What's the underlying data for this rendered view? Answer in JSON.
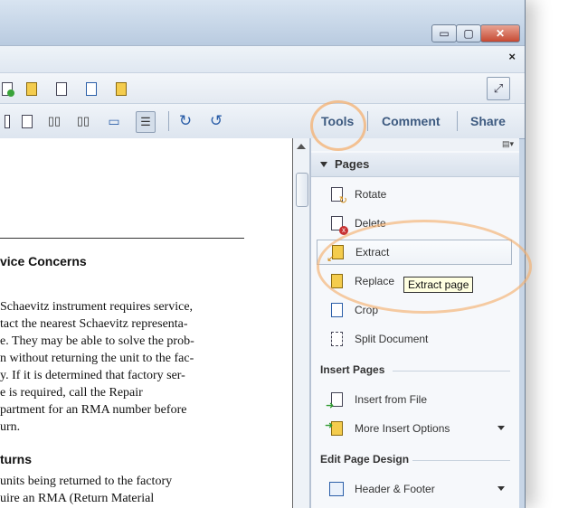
{
  "toolbar": {
    "tabs": {
      "tools": "Tools",
      "comment": "Comment",
      "share": "Share"
    },
    "menu_close": "×"
  },
  "window_controls": {
    "minimize": "▭",
    "maximize": "▢",
    "close": "✕"
  },
  "document": {
    "heading1": "vice Concerns",
    "para1": [
      "Schaevitz instrument requires service,",
      "tact the nearest Schaevitz representa-",
      "e. They may be able to solve the prob-",
      "n without returning the unit to the fac-",
      "y. If it is determined that factory ser-",
      "e is required, call the Repair",
      "partment for an RMA number before",
      "urn."
    ],
    "heading2": "turns",
    "para2": [
      "units being returned to the factory",
      "uire an RMA (Return Material"
    ]
  },
  "pane": {
    "options_icon": "▤▾",
    "section": "Pages",
    "pages_items": [
      {
        "label": "Rotate"
      },
      {
        "label": "Delete"
      },
      {
        "label": "Extract"
      },
      {
        "label": "Replace"
      },
      {
        "label": "Crop"
      },
      {
        "label": "Split Document"
      }
    ],
    "insert_title": "Insert Pages",
    "insert_items": [
      {
        "label": "Insert from File"
      },
      {
        "label": "More Insert Options"
      }
    ],
    "design_title": "Edit Page Design",
    "design_items": [
      {
        "label": "Header & Footer"
      }
    ]
  },
  "tooltip": "Extract page"
}
